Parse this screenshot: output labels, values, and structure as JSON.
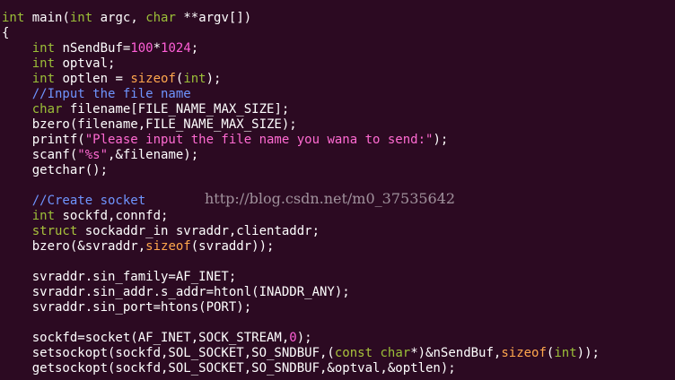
{
  "code_lines": [
    [
      {
        "t": "int",
        "c": "ty"
      },
      {
        "t": " main("
      },
      {
        "t": "int",
        "c": "ty"
      },
      {
        "t": " argc, "
      },
      {
        "t": "char",
        "c": "ty"
      },
      {
        "t": " **argv[])"
      }
    ],
    [
      {
        "t": "{"
      }
    ],
    [
      {
        "t": "    "
      },
      {
        "t": "int",
        "c": "ty"
      },
      {
        "t": " nSendBuf="
      },
      {
        "t": "100",
        "c": "num"
      },
      {
        "t": "*"
      },
      {
        "t": "1024",
        "c": "num"
      },
      {
        "t": ";"
      }
    ],
    [
      {
        "t": "    "
      },
      {
        "t": "int",
        "c": "ty"
      },
      {
        "t": " optval;"
      }
    ],
    [
      {
        "t": "    "
      },
      {
        "t": "int",
        "c": "ty"
      },
      {
        "t": " optlen = "
      },
      {
        "t": "sizeof",
        "c": "op"
      },
      {
        "t": "("
      },
      {
        "t": "int",
        "c": "ty"
      },
      {
        "t": ");"
      }
    ],
    [
      {
        "t": "    "
      },
      {
        "t": "//Input the file name",
        "c": "cm"
      }
    ],
    [
      {
        "t": "    "
      },
      {
        "t": "char",
        "c": "ty"
      },
      {
        "t": " filename[FILE_NAME_MAX_SIZE];"
      }
    ],
    [
      {
        "t": "    bzero(filename,FILE_NAME_MAX_SIZE);"
      }
    ],
    [
      {
        "t": "    printf("
      },
      {
        "t": "\"Please input the file name you wana to send:\"",
        "c": "str"
      },
      {
        "t": ");"
      }
    ],
    [
      {
        "t": "    scanf("
      },
      {
        "t": "\"%s\"",
        "c": "str"
      },
      {
        "t": ",&filename);"
      }
    ],
    [
      {
        "t": "    getchar();"
      }
    ],
    [
      {
        "t": ""
      }
    ],
    [
      {
        "t": "    "
      },
      {
        "t": "//Create socket",
        "c": "cm"
      }
    ],
    [
      {
        "t": "    "
      },
      {
        "t": "int",
        "c": "ty"
      },
      {
        "t": " sockfd,connfd;"
      }
    ],
    [
      {
        "t": "    "
      },
      {
        "t": "struct",
        "c": "kw"
      },
      {
        "t": " sockaddr_in svraddr,clientaddr;"
      }
    ],
    [
      {
        "t": "    bzero(&svraddr,"
      },
      {
        "t": "sizeof",
        "c": "op"
      },
      {
        "t": "(svraddr));"
      }
    ],
    [
      {
        "t": ""
      }
    ],
    [
      {
        "t": "    svraddr.sin_family=AF_INET;"
      }
    ],
    [
      {
        "t": "    svraddr.sin_addr.s_addr=htonl(INADDR_ANY);"
      }
    ],
    [
      {
        "t": "    svraddr.sin_port=htons(PORT);"
      }
    ],
    [
      {
        "t": ""
      }
    ],
    [
      {
        "t": "    sockfd=socket(AF_INET,SOCK_STREAM,"
      },
      {
        "t": "0",
        "c": "num"
      },
      {
        "t": ");"
      }
    ],
    [
      {
        "t": "    setsockopt(sockfd,SOL_SOCKET,SO_SNDBUF,("
      },
      {
        "t": "const",
        "c": "kw"
      },
      {
        "t": " "
      },
      {
        "t": "char",
        "c": "ty"
      },
      {
        "t": "*)&nSendBuf,"
      },
      {
        "t": "sizeof",
        "c": "op"
      },
      {
        "t": "("
      },
      {
        "t": "int",
        "c": "ty"
      },
      {
        "t": "));"
      }
    ],
    [
      {
        "t": "    getsockopt(sockfd,SOL_SOCKET,SO_SNDBUF,&optval,&optlen);"
      }
    ]
  ],
  "watermark": "http://blog.csdn.net/m0_37535642"
}
